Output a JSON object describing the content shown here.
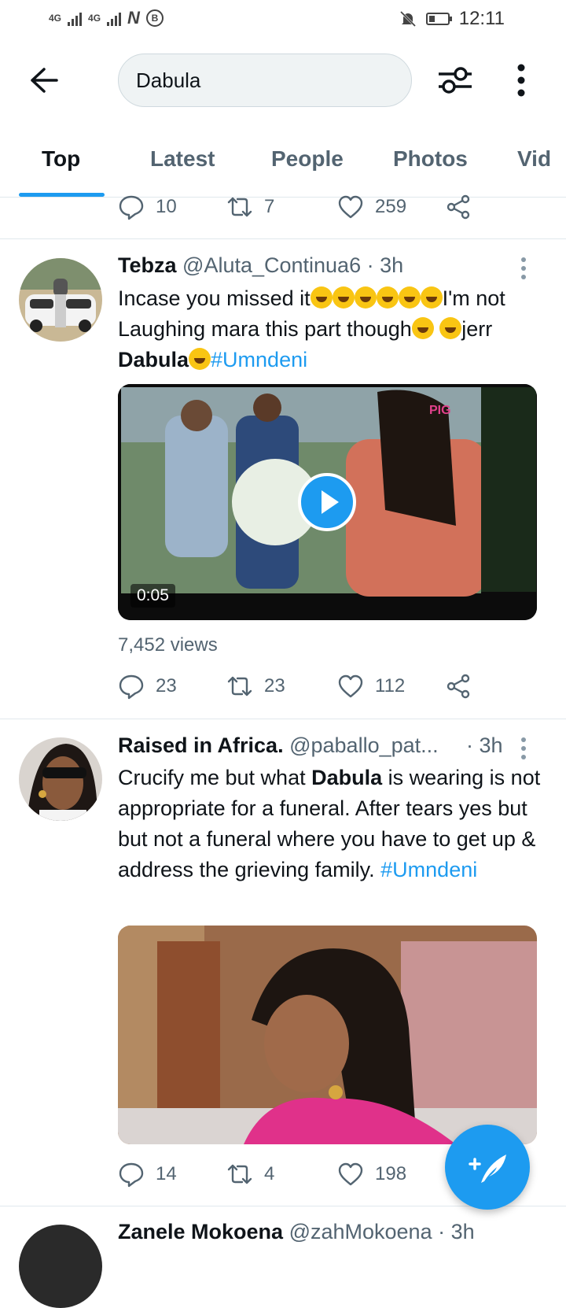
{
  "status_bar": {
    "net1": "4G",
    "net2": "4G",
    "time": "12:11"
  },
  "search": {
    "query": "Dabula"
  },
  "tabs": [
    "Top",
    "Latest",
    "People",
    "Photos",
    "Vid"
  ],
  "prev_tweet": {
    "replies": "10",
    "retweets": "7",
    "likes": "259"
  },
  "tweets": [
    {
      "name": "Tebza",
      "handle": "@Aluta_Continua6",
      "time": "· 3h",
      "text_a": "Incase you missed it",
      "text_b": "I'm not Laughing mara this part though",
      "text_c": "jerr ",
      "bold": "Dabula",
      "hashtag": "#Umndeni",
      "duration": "0:05",
      "views": "7,452 views",
      "replies": "23",
      "retweets": "23",
      "likes": "112"
    },
    {
      "name": "Raised in Africa.",
      "handle": "@paballo_pat...",
      "time": "· 3h",
      "text_a": "Crucify me but what ",
      "bold": "Dabula",
      "text_b": " is wearing is not appropriate for a funeral. After tears yes but but not a funeral where you have to get up & address the grieving family. ",
      "hashtag": "#Umndeni",
      "replies": "14",
      "retweets": "4",
      "likes": "198"
    },
    {
      "name": "Zanele Mokoena",
      "handle": "@zahMokoena",
      "time": "· 3h"
    }
  ],
  "colors": {
    "accent": "#1d9bf0",
    "text": "#0f1419",
    "muted": "#536471"
  }
}
